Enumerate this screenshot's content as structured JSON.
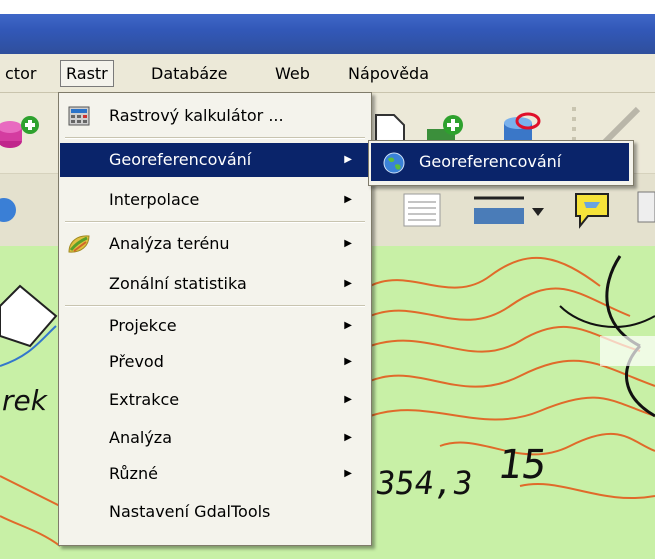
{
  "menubar": {
    "items": [
      {
        "label": "ctor"
      },
      {
        "label": "Rastr"
      },
      {
        "label": "Databáze"
      },
      {
        "label": "Web"
      },
      {
        "label": "Nápověda"
      }
    ]
  },
  "raster_menu": {
    "items": [
      {
        "label": "Rastrový kalkulátor ...",
        "icon": "raster-calculator-icon"
      },
      {
        "label": "Georeferencování",
        "submenu": true
      },
      {
        "label": "Interpolace",
        "submenu": true
      },
      {
        "label": "Analýza terénu",
        "submenu": true,
        "icon": "terrain-analysis-icon"
      },
      {
        "label": "Zonální statistika",
        "submenu": true
      },
      {
        "label": "Projekce",
        "submenu": true
      },
      {
        "label": "Převod",
        "submenu": true
      },
      {
        "label": "Extrakce",
        "submenu": true
      },
      {
        "label": "Analýza",
        "submenu": true
      },
      {
        "label": "Různé",
        "submenu": true
      },
      {
        "label": "Nastavení GdalTools"
      }
    ]
  },
  "georef_submenu": {
    "items": [
      {
        "label": "Georeferencování",
        "icon": "globe-icon"
      }
    ]
  },
  "map": {
    "label_rek": "rek",
    "label_elev": "354,3",
    "label_15": "15"
  },
  "colors": {
    "highlight": "#0a246a",
    "menu_bg": "#f4f3ec",
    "map_green": "#c8f0a6",
    "contour": "#e06a2a"
  }
}
